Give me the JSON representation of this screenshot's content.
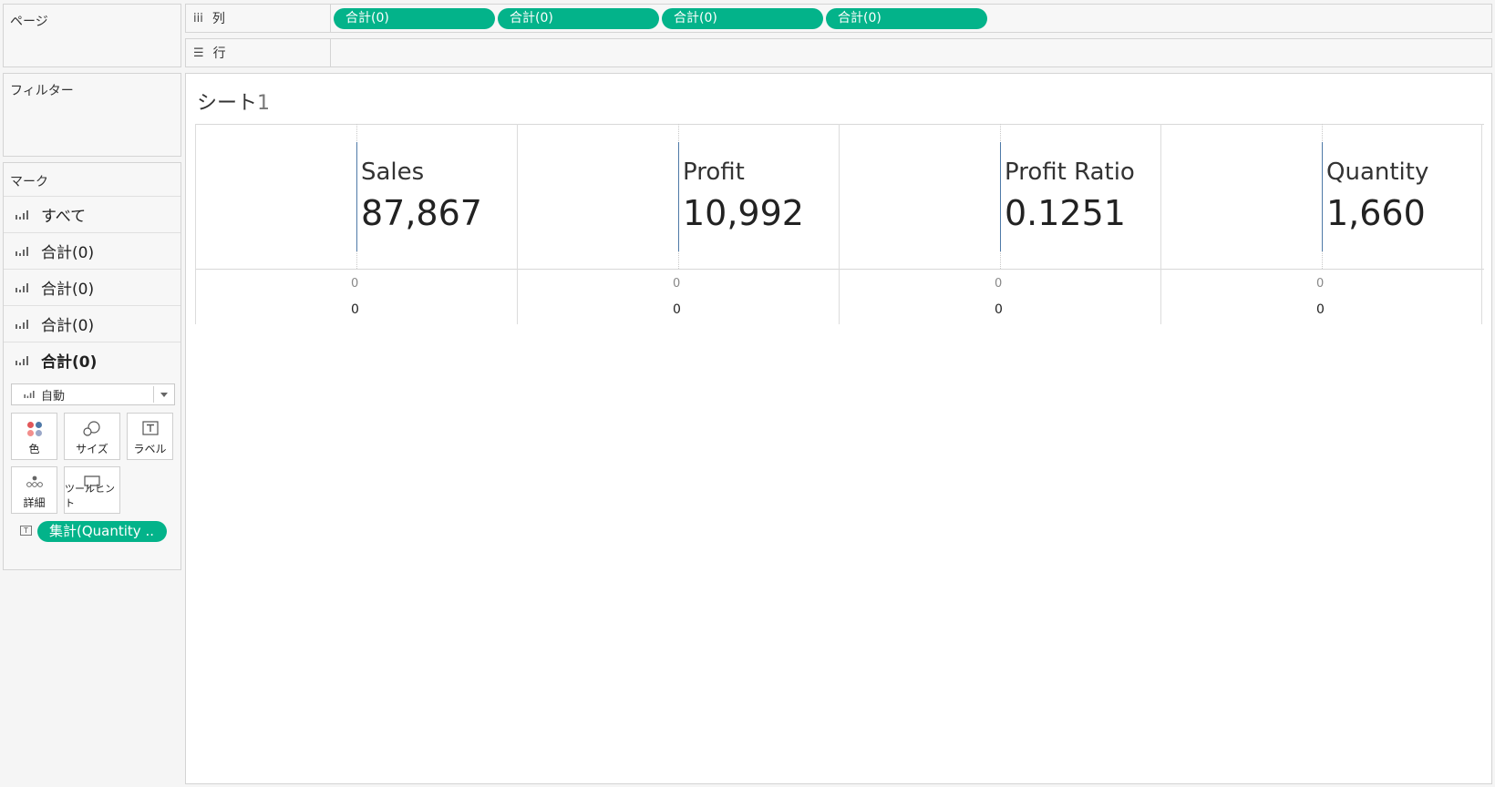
{
  "left_panel": {
    "pages_title": "ページ",
    "filters_title": "フィルター",
    "marks_title": "マーク",
    "mark_rows": [
      {
        "label": "すべて"
      },
      {
        "label": "合計(0)"
      },
      {
        "label": "合計(0)"
      },
      {
        "label": "合計(0)"
      },
      {
        "label": "合計(0)"
      }
    ],
    "mark_type": "自動",
    "buttons": {
      "color": "色",
      "size": "サイズ",
      "label": "ラベル",
      "detail": "詳細",
      "tooltip": "ツールヒント"
    },
    "label_pill": "集計(Quantity ..",
    "label_pill_icon": "text-label-icon"
  },
  "shelves": {
    "columns_label": "列",
    "rows_label": "行",
    "column_pills": [
      "合計(0)",
      "合計(0)",
      "合計(0)",
      "合計(0)"
    ]
  },
  "sheet": {
    "title": "シート",
    "number": "1"
  },
  "chart_data": {
    "type": "table",
    "measures": [
      {
        "label": "Sales",
        "value": "87,867"
      },
      {
        "label": "Profit",
        "value": "10,992"
      },
      {
        "label": "Profit Ratio",
        "value": "0.1251"
      },
      {
        "label": "Quantity",
        "value": "1,660"
      }
    ],
    "tick_label": "0",
    "axis_label": "0"
  },
  "colors": {
    "pill": "#03b38a",
    "bar": "#4e79a7"
  }
}
